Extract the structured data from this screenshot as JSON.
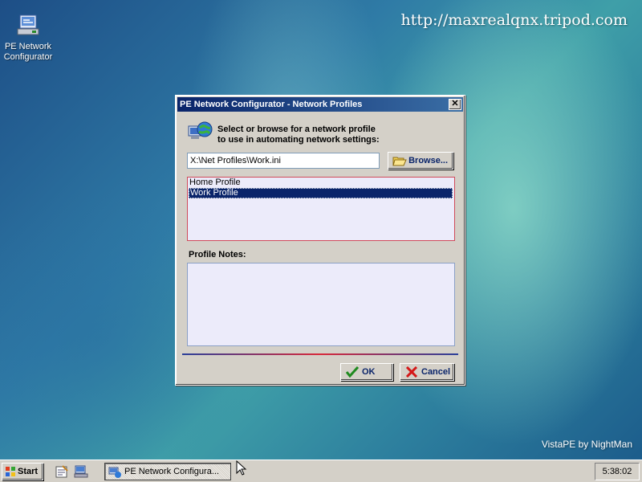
{
  "desktop": {
    "watermark": "http://maxrealqnx.tripod.com",
    "credit": "VistaPE by NightMan",
    "icons": [
      {
        "label": "PE Network Configurator",
        "icon": "network-config-icon"
      }
    ]
  },
  "dialog": {
    "title": "PE Network Configurator - Network Profiles",
    "close_label": "✕",
    "prompt_line1": "Select or browse for a network profile",
    "prompt_line2": "to use in automating network settings:",
    "path_value": "X:\\Net Profiles\\Work.ini",
    "browse_label": "Browse...",
    "profiles": [
      {
        "label": "Home Profile",
        "selected": false
      },
      {
        "label": "Work Profile",
        "selected": true
      }
    ],
    "notes_label": "Profile Notes:",
    "notes_value": "",
    "ok_label": "OK",
    "cancel_label": "Cancel",
    "colors": {
      "title_start": "#0a246a",
      "title_end": "#3a6ea5",
      "list_border": "#d04a5a"
    }
  },
  "taskbar": {
    "start_label": "Start",
    "task_label": "PE Network Configura...",
    "clock": "5:38:02"
  }
}
